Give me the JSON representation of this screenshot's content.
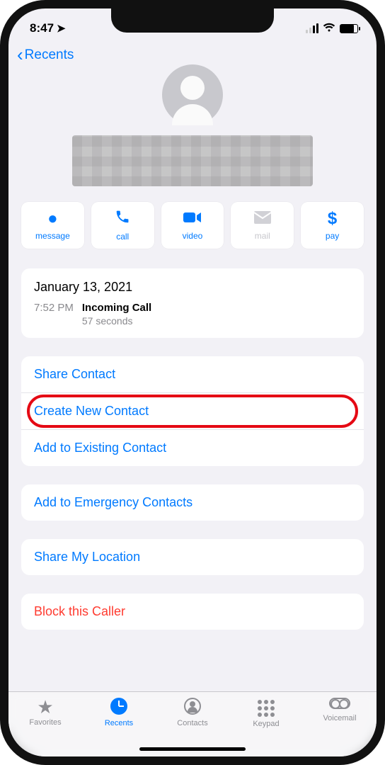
{
  "status": {
    "time": "8:47"
  },
  "nav": {
    "back_label": "Recents"
  },
  "actions": {
    "message": "message",
    "call": "call",
    "video": "video",
    "mail": "mail",
    "pay": "pay"
  },
  "call_log": {
    "date": "January 13, 2021",
    "time": "7:52 PM",
    "type": "Incoming Call",
    "duration": "57 seconds"
  },
  "links": {
    "share_contact": "Share Contact",
    "create_new": "Create New Contact",
    "add_existing": "Add to Existing Contact",
    "add_emergency": "Add to Emergency Contacts",
    "share_location": "Share My Location",
    "block": "Block this Caller"
  },
  "tabs": {
    "favorites": "Favorites",
    "recents": "Recents",
    "contacts": "Contacts",
    "keypad": "Keypad",
    "voicemail": "Voicemail"
  }
}
